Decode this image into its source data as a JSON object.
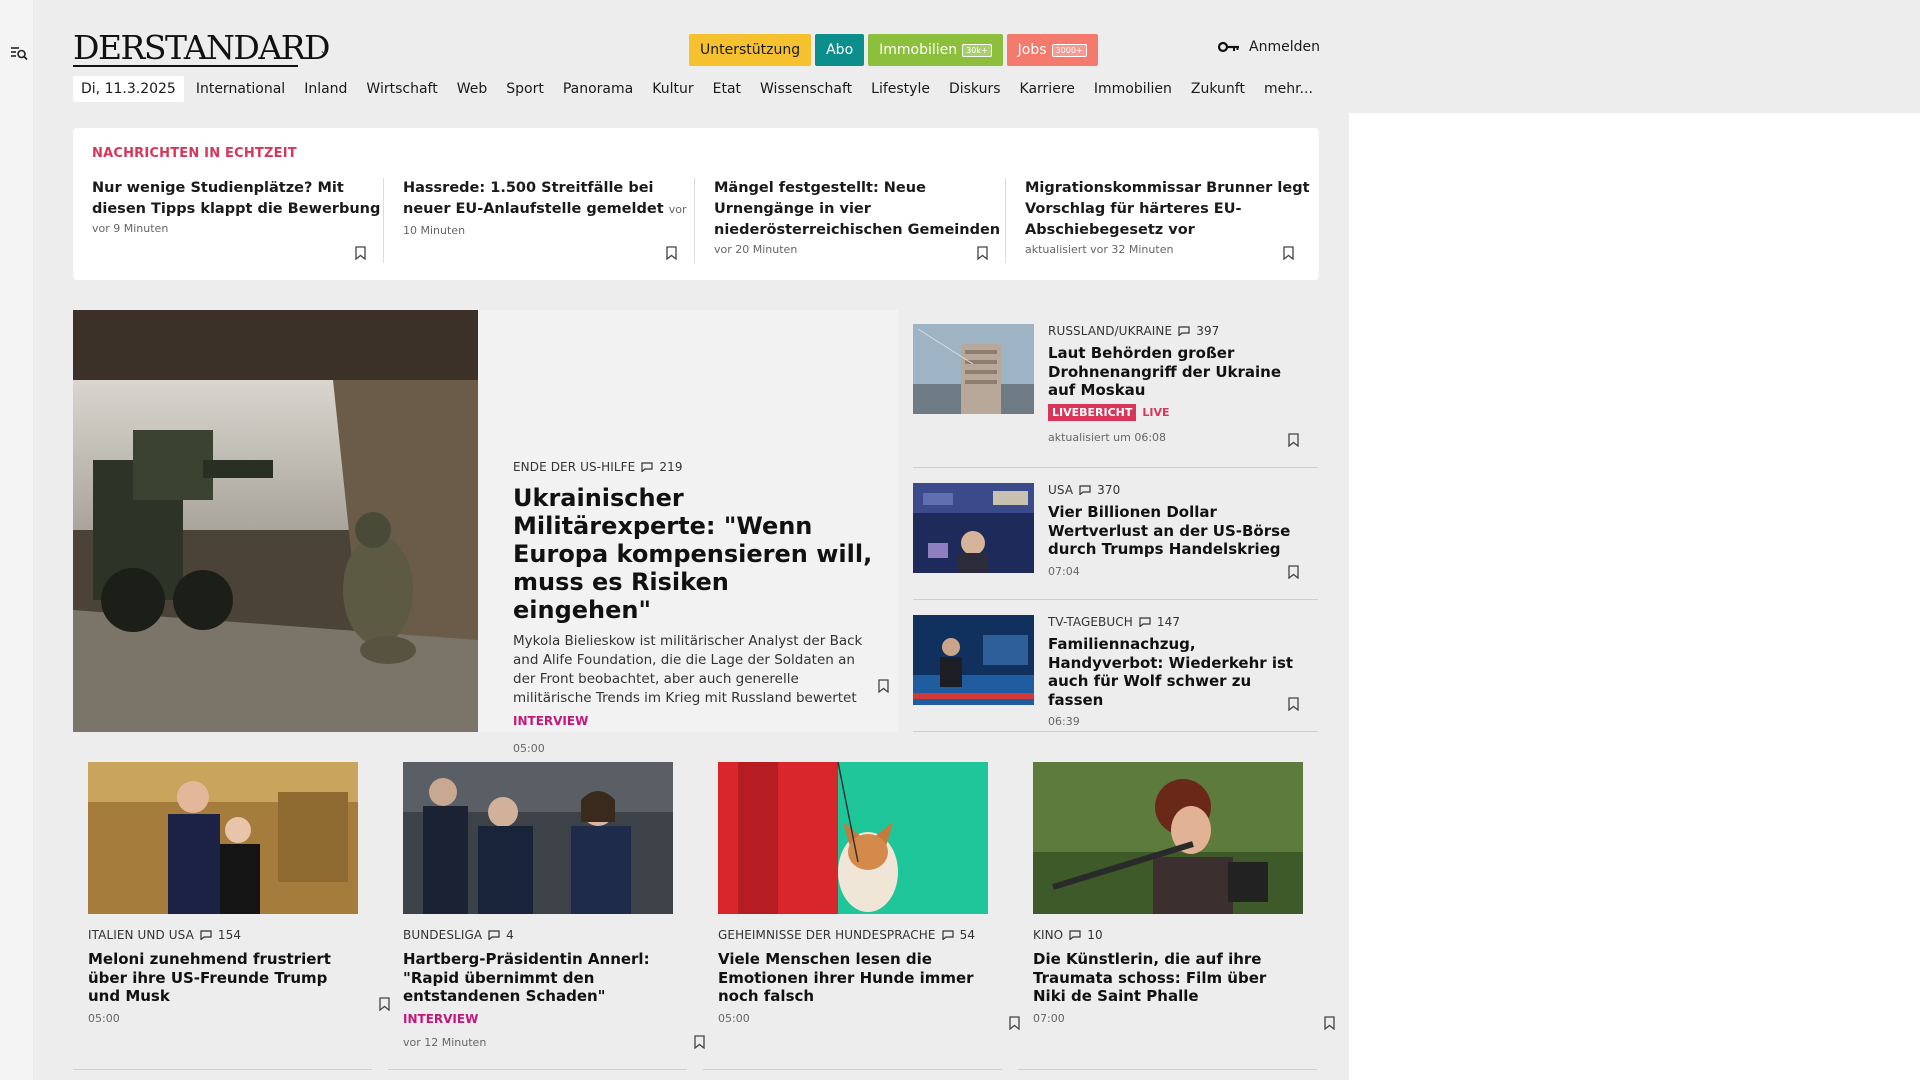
{
  "header": {
    "logo": "DERSTANDARD",
    "buttons": {
      "support": "Unterstützung",
      "abo": "Abo",
      "immobilien": "Immobilien",
      "immobilien_tag": "30k+",
      "jobs": "Jobs",
      "jobs_tag": "3000+"
    },
    "login": "Anmelden"
  },
  "nav": {
    "date": "Di, 11.3.2025",
    "items": [
      "International",
      "Inland",
      "Wirtschaft",
      "Web",
      "Sport",
      "Panorama",
      "Kultur",
      "Etat",
      "Wissenschaft",
      "Lifestyle",
      "Diskurs",
      "Karriere",
      "Immobilien",
      "Zukunft",
      "mehr..."
    ]
  },
  "ticker": {
    "title": "NACHRICHTEN IN ECHTZEIT",
    "items": [
      {
        "headline": "Nur wenige Studienplätze? Mit diesen Tipps klappt die Bewerbung",
        "time": "vor 9 Minuten"
      },
      {
        "headline": "Hassrede: 1.500 Streitfälle bei neuer EU-Anlaufstelle gemeldet",
        "time": "vor 10 Minuten"
      },
      {
        "headline": "Mängel festgestellt: Neue Urnengänge in vier niederösterreichischen Gemeinden",
        "time": "vor 20 Minuten"
      },
      {
        "headline": "Migrationskommissar Brunner legt Vorschlag für härteres EU-Abschiebegesetz vor",
        "time": "aktualisiert vor 32 Minuten"
      }
    ]
  },
  "hero": {
    "kicker": "ENDE DER US-HILFE",
    "comments": "219",
    "headline": "Ukrainischer Militärexperte: \"Wenn Europa kompensieren will, muss es Risiken eingehen\"",
    "lead": "Mykola Bielieskow ist militärischer Analyst der Back and Alife Foundation, die die Lage der Soldaten an der Front beobachtet, aber auch generelle militärische Trends im Krieg mit Russland bewertet",
    "label": "INTERVIEW",
    "time": "05:00"
  },
  "side": [
    {
      "kicker": "RUSSLAND/UKRAINE",
      "comments": "397",
      "headline": "Laut Behörden großer Drohnenangriff der Ukraine auf Moskau",
      "badge": "LIVEBERICHT",
      "live": "LIVE",
      "time": "aktualisiert um 06:08"
    },
    {
      "kicker": "USA",
      "comments": "370",
      "headline": "Vier Billionen Dollar Wertverlust an der US-Börse durch Trumps Handelskrieg",
      "time": "07:04"
    },
    {
      "kicker": "TV-TAGEBUCH",
      "comments": "147",
      "headline": "Familiennachzug, Handyverbot: Wiederkehr ist auch für Wolf schwer zu fassen",
      "time": "06:39"
    }
  ],
  "cards": [
    {
      "kicker": "ITALIEN UND USA",
      "comments": "154",
      "headline": "Meloni zunehmend frustriert über ihre US-Freunde Trump und Musk",
      "time": "05:00"
    },
    {
      "kicker": "BUNDESLIGA",
      "comments": "4",
      "headline": "Hartberg-Präsidentin Annerl: \"Rapid übernimmt den entstandenen Schaden\"",
      "label": "INTERVIEW",
      "time": "vor 12 Minuten"
    },
    {
      "kicker": "GEHEIMNISSE DER HUNDESPRACHE",
      "comments": "54",
      "headline": "Viele Menschen lesen die Emotionen ihrer Hunde immer noch falsch",
      "time": "05:00"
    },
    {
      "kicker": "KINO",
      "comments": "10",
      "headline": "Die Künstlerin, die auf ihre Traumata schoss: Film über Niki de Saint Phalle",
      "time": "07:00"
    }
  ]
}
